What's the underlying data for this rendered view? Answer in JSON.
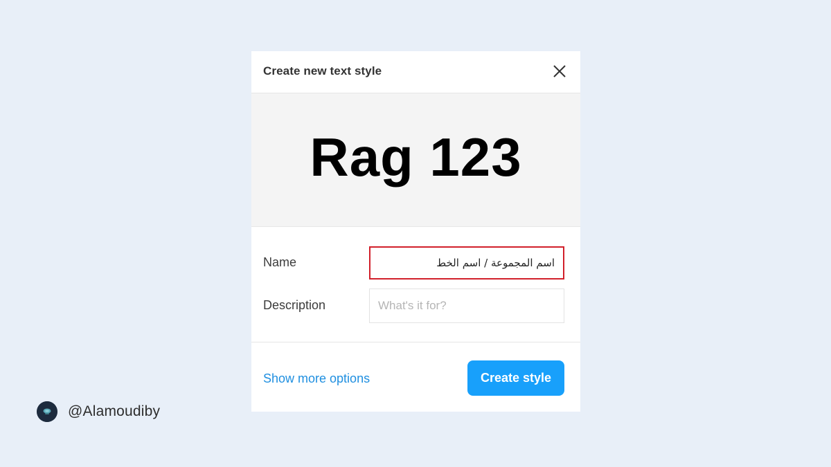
{
  "dialog": {
    "title": "Create new text style",
    "close_icon": "close-icon",
    "preview_text": "Rag 123",
    "name_label": "Name",
    "name_value": "اسم المجموعة / اسم الخط",
    "description_label": "Description",
    "description_placeholder": "What's it for?",
    "more_options_label": "Show more options",
    "create_button_label": "Create style"
  },
  "author": {
    "avatar_icon": "avatar-icon",
    "handle": "@Alamoudiby"
  },
  "colors": {
    "background": "#e8eff8",
    "accent": "#18a0fb",
    "link": "#1f8fe0",
    "highlight_border": "#d11f2a"
  }
}
